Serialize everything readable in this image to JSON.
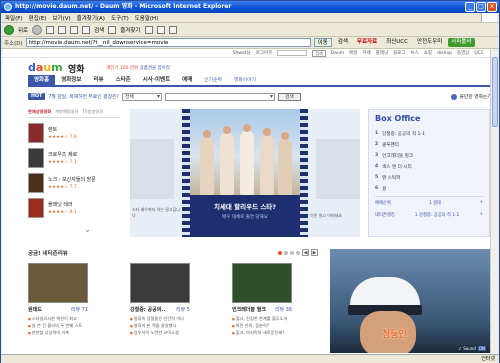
{
  "window": {
    "title": "http://movie.daum.net/ - Daum 영화 - Microsoft Internet Explorer",
    "minimize": "_",
    "maximize": "□",
    "close": "×"
  },
  "menubar": [
    "파일(F)",
    "편집(E)",
    "보기(V)",
    "즐겨찾기(A)",
    "도구(T)",
    "도움말(H)"
  ],
  "toolbar": {
    "back": "뒤로",
    "search": "검색",
    "favorites": "즐겨찾기"
  },
  "addressbar": {
    "label": "주소(D)",
    "url": "http://movie.daum.net/?t__nil_downservice=movie",
    "go": "이동",
    "search": "검색",
    "free_download": "무료자료",
    "ucc": "최신UCC",
    "safe": "안전도우미",
    "brand": "사파툴바"
  },
  "status": {
    "zone": "인터넷"
  },
  "topnav": {
    "links": [
      "Shwat님",
      "로그아웃",
      "Daum",
      "메일",
      "카페",
      "플래닛",
      "블로그",
      "뉴스",
      "쇼핑",
      "dishop",
      "동영상",
      "UCC"
    ],
    "search_button": "검색"
  },
  "header": {
    "logo": {
      "d": "d",
      "a": "a",
      "u": "u",
      "m": "m"
    },
    "section": "영화",
    "promo_a": "개인기 100 만원",
    "promo_b": " 상품권을 잡아라"
  },
  "nav": {
    "tabs": [
      "영화홈",
      "영화정보",
      "리뷰",
      "스타존",
      "시사·이벤트",
      "예매",
      "인기순위",
      "영화이야기"
    ]
  },
  "search": {
    "hot_badge": "HOT",
    "hot_text": "7월 한일, 목해하면 무료인 결정은?",
    "category": "전체",
    "query": "",
    "button": "검색",
    "cs_link": "불만한 영화는?"
  },
  "left": {
    "tabs": [
      "현재상영영화",
      "개봉예정영화",
      "TV방영영화"
    ],
    "movies": [
      {
        "title": "렌트",
        "rating": "★★★★☆ 7.8",
        "color": "#8b2a2a"
      },
      {
        "title": "크로우즈 제로",
        "rating": "★★★★☆ 7.1",
        "color": "#3a3a3a"
      },
      {
        "title": "노크 : 보신자들의 방문",
        "rating": "★★★★☆ 7.7",
        "color": "#4a2f1a"
      },
      {
        "title": "플래닛 테러",
        "rating": "★★★★☆ 8.1",
        "color": "#9a2c1c"
      }
    ]
  },
  "banner": {
    "title": "치세대 할리우드 스타?",
    "subtitle": "배우 대체로 출연 당해요",
    "left_caption": "스타 배우까지 아는 밀고답니다",
    "right_caption": "이런 밀고 어떠세요"
  },
  "boxoffice": {
    "title": "Box Office",
    "items": [
      {
        "num": "1",
        "name": "강철중: 공공의 적 1-1"
      },
      {
        "num": "2",
        "name": "쿵푸팬더"
      },
      {
        "num": "3",
        "name": "인크레더블 헐크"
      },
      {
        "num": "4",
        "name": "섹스 앤 더 시티"
      },
      {
        "num": "5",
        "name": "맨 스탁퍼"
      },
      {
        "num": "6",
        "name": "걸"
      }
    ],
    "rate_label": "예매순위",
    "rate_item": "1 원데",
    "reviewer_label": "네티즌랭킹",
    "reviewer_item": "1 강철중: 공공의 적 1-1"
  },
  "section": {
    "title": "궁금! 네티즌리뷰",
    "prev": "◀",
    "next": "▶"
  },
  "cards": [
    {
      "title": "원데드",
      "count": "리뷰 71",
      "color": "#6b5a3a",
      "lines": [
        "스타일리시한 액션이 최고",
        "날 쓴 건 콜러의 두 번째 스토",
        "만만찮 상상력의 기축"
      ]
    },
    {
      "title": "강철중: 공공의..",
      "count": "리뷰 5",
      "color": "#3c3c3c",
      "lines": [
        "영화속 강철중은 인간적 이다",
        "영화의 본 맥을 살실했다",
        "강우석이 노련한 코믹소설"
      ]
    },
    {
      "title": "인크레더블 헐크",
      "count": "리뷰 36",
      "color": "#2f4e2a",
      "lines": [
        "헐크, 진정한 한계를 볼무도어",
        "마린 안의, 증분히?",
        "헐크, 마지막의 새로운진짜?"
      ]
    }
  ],
  "video": {
    "subtitle": "청둥인",
    "sound": "Sound",
    "on": "ON"
  }
}
